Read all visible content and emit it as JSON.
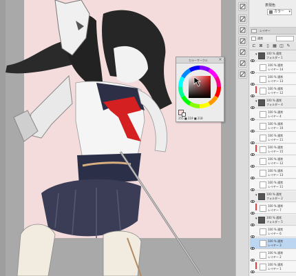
{
  "colors": {
    "accent_highlight": "#ff2a7a",
    "canvas_page": "#f4dcdc",
    "selected_layer": "#bcd6f1",
    "panel_bg": "#e8e8e8"
  },
  "properties": {
    "label": "表現色",
    "color_mode": "カラー"
  },
  "layer_panel": {
    "tab_label": "レイヤー",
    "blend_mode": "通常"
  },
  "color_palette": {
    "title": "カラーサークル",
    "values_text": "255 ■ 219 ■ 218"
  },
  "tool_icons": [
    "tool-icon-1",
    "tool-icon-2",
    "tool-icon-3",
    "tool-icon-4",
    "tool-icon-5",
    "tool-icon-6",
    "tool-icon-7"
  ],
  "layers": [
    {
      "mode": "100 % 通常",
      "name": "フォルダー 1",
      "folder": true
    },
    {
      "mode": "100 % 通常",
      "name": "レイヤー 14"
    },
    {
      "mode": "100 % 通常",
      "name": "レイヤー 13"
    },
    {
      "mode": "100 % 通常",
      "name": "レイヤー 12"
    },
    {
      "mode": "100 % 通常",
      "name": "フォルダー 4",
      "folder": true
    },
    {
      "mode": "100 % 通常",
      "name": "レイヤー 4"
    },
    {
      "mode": "100 % 通常",
      "name": "レイヤー 10"
    },
    {
      "mode": "100 % 通常",
      "name": "レイヤー 11"
    },
    {
      "mode": "100 % 通常",
      "name": "レイヤー 15"
    },
    {
      "mode": "100 % 通常",
      "name": "レイヤー 12"
    },
    {
      "mode": "100 % 通常",
      "name": "レイヤー 13"
    },
    {
      "mode": "100 % 通常",
      "name": "レイヤー 11"
    },
    {
      "mode": "100 % 通常",
      "name": "フォルダー 2",
      "folder": true
    },
    {
      "mode": "100 % 通常",
      "name": "レイヤー 7"
    },
    {
      "mode": "100 % 通常",
      "name": "フォルダー 5",
      "folder": true
    },
    {
      "mode": "100 % 通常",
      "name": "レイヤー 6"
    },
    {
      "mode": "100 % 通常",
      "name": "レイヤー 3",
      "selected": true
    },
    {
      "mode": "100 % 通常",
      "name": "レイヤー 2"
    },
    {
      "mode": "100 % 通常",
      "name": "レイヤー 1"
    }
  ]
}
